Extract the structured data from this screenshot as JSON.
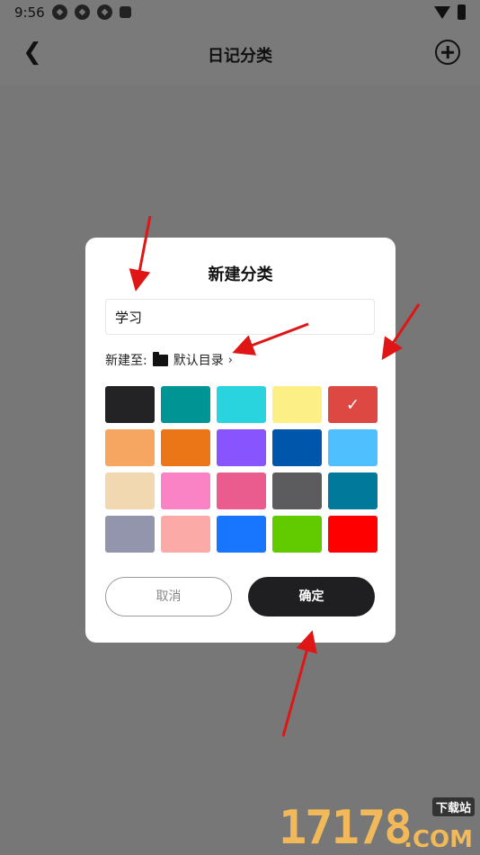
{
  "status_bar": {
    "time": "9:56"
  },
  "header": {
    "back_icon": "chevron-left-icon",
    "title": "日记分类",
    "add_icon": "plus-circle-icon"
  },
  "dialog": {
    "title": "新建分类",
    "input_value": "学习",
    "location_label": "新建至:",
    "location_icon": "folder-icon",
    "location_name": "默认目录",
    "chevron": "›",
    "colors": [
      {
        "hex": "#232326",
        "selected": false
      },
      {
        "hex": "#009595",
        "selected": false
      },
      {
        "hex": "#2ad4de",
        "selected": false
      },
      {
        "hex": "#fcef86",
        "selected": false
      },
      {
        "hex": "#de4842",
        "selected": true
      },
      {
        "hex": "#f7a661",
        "selected": false
      },
      {
        "hex": "#eb7617",
        "selected": false
      },
      {
        "hex": "#8754fd",
        "selected": false
      },
      {
        "hex": "#0056aa",
        "selected": false
      },
      {
        "hex": "#4fc0fd",
        "selected": false
      },
      {
        "hex": "#f1d8b0",
        "selected": false
      },
      {
        "hex": "#fa83c6",
        "selected": false
      },
      {
        "hex": "#ea5c8e",
        "selected": false
      },
      {
        "hex": "#5c5c5e",
        "selected": false
      },
      {
        "hex": "#00799a",
        "selected": false
      },
      {
        "hex": "#9395ad",
        "selected": false
      },
      {
        "hex": "#fbaaa7",
        "selected": false
      },
      {
        "hex": "#1875fe",
        "selected": false
      },
      {
        "hex": "#62cb00",
        "selected": false
      },
      {
        "hex": "#fe0000",
        "selected": false
      }
    ],
    "cancel_label": "取消",
    "confirm_label": "确定"
  },
  "watermark": {
    "digits": "17178",
    "com": ".COM",
    "tag": "下载站"
  },
  "colors": {
    "overlay": "#777777",
    "annotation_arrow": "#e01515",
    "confirm_bg": "#1f1f22"
  }
}
